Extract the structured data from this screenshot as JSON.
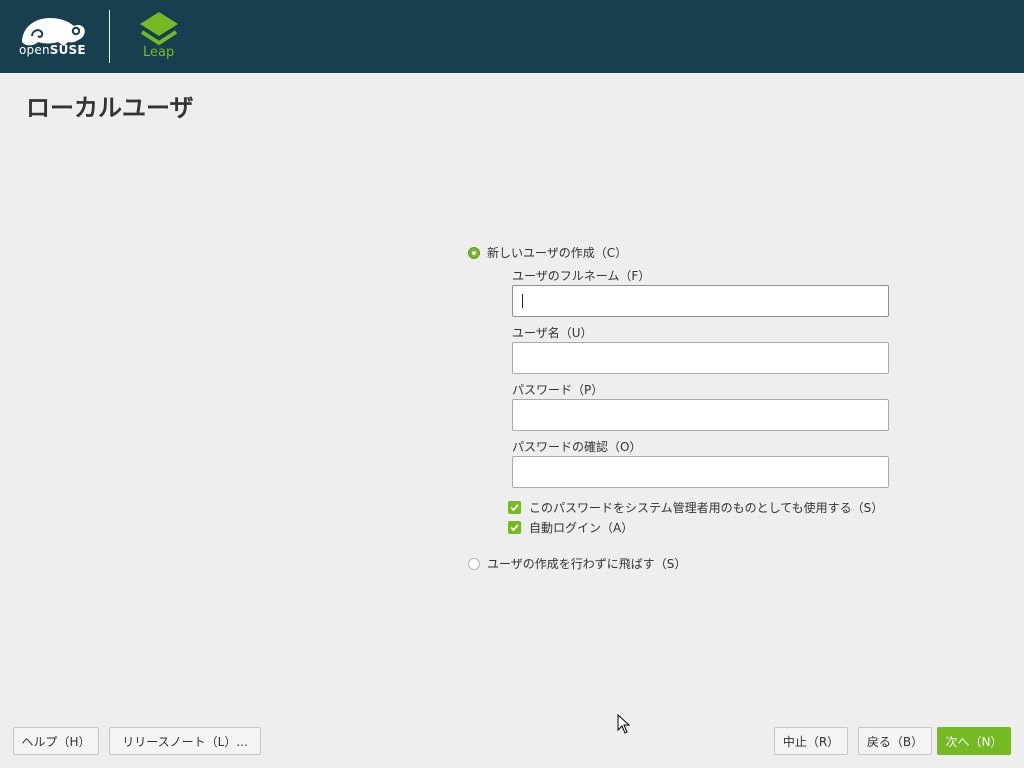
{
  "header": {
    "brand_prefix": "open",
    "brand_name": "SUSE",
    "product": "Leap",
    "accent_color": "#73ba25",
    "background_color": "#173f4f",
    "brand_icon": "chameleon-logo-icon",
    "product_icon": "leap-logo-icon"
  },
  "page": {
    "title": "ローカルユーザ"
  },
  "form": {
    "create_user_option": "新しいユーザの作成（C）",
    "full_name_label": "ユーザのフルネーム（F）",
    "full_name_value": "",
    "username_label": "ユーザ名（U）",
    "username_value": "",
    "password_label": "パスワード（P）",
    "password_value": "",
    "confirm_label": "パスワードの確認（O）",
    "confirm_value": "",
    "use_for_admin_label": "このパスワードをシステム管理者用のものとしても使用する（S）",
    "use_for_admin_checked": true,
    "autologin_label": "自動ログイン（A）",
    "autologin_checked": true,
    "skip_option": "ユーザの作成を行わずに飛ばす（S）"
  },
  "footer": {
    "help": "ヘルプ（H）",
    "release_notes": "リリースノート（L）...",
    "abort": "中止（R）",
    "back": "戻る（B）",
    "next": "次へ（N）"
  }
}
